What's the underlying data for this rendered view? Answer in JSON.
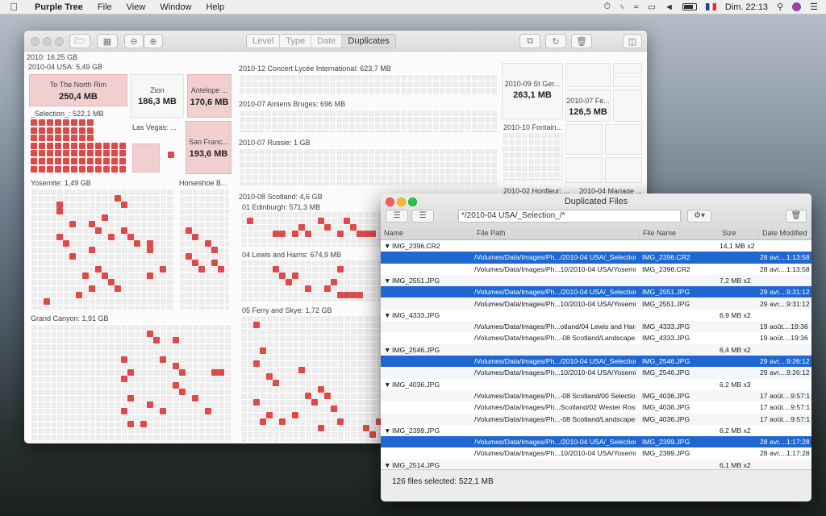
{
  "menubar": {
    "app_name": "Purple Tree",
    "items": [
      "File",
      "View",
      "Window",
      "Help"
    ],
    "clock": "Dim. 22:13"
  },
  "main_window": {
    "view_tabs": [
      "Level",
      "Type",
      "Date",
      "Duplicates"
    ],
    "selected_view_tab": "Duplicates",
    "treemap": {
      "root_label": "2010: 16,25 GB",
      "usa_label": "2010-04 USA: 5,49 GB",
      "north_rim_name": "To The North Rim",
      "north_rim_size": "250,4 MB",
      "zion_name": "Zion",
      "zion_size": "186,3 MB",
      "antelope_name": "Antelope ...",
      "antelope_size": "170,6 MB",
      "selection_label": "_Selection_: 522,1 MB",
      "las_vegas_label": "Las Vegas: ...",
      "san_fran_name": "San Franc...",
      "san_fran_size": "193,6 MB",
      "yosemite_label": "Yosemite: 1,49 GB",
      "horseshoe_label": "Horseshoe B...",
      "grand_canyon_label": "Grand Canyon: 1,91 GB",
      "concert_label": "2010-12 Concert Lycée International: 623,7 MB",
      "amiens_label": "2010-07 Amiens Bruges: 696 MB",
      "russie_label": "2010-07 Russie: 1 GB",
      "scotland_label": "2010-08 Scotland: 4,6 GB",
      "edinburgh_label": "01 Edinburgh: 571,3 MB",
      "lewis_label": "04 Lewis and Harris: 674,9 MB",
      "ferry_label": "05 Ferry and Skye: 1,72 GB",
      "st_ger_name": "2010-09 St Ger...",
      "st_ger_size": "263,1 MB",
      "fe_name": "2010-07 Fe...",
      "fe_size": "126,5 MB",
      "fontain_label": "2010-10 Fontain...",
      "honfleur_label": "2010-02 Honfleur: ...",
      "mariage_label": "2010-04 Mariage ..."
    }
  },
  "dup_window": {
    "title": "Duplicated Files",
    "path_value": "*/2010-04 USA/_Selection_/*",
    "columns": [
      "Name",
      "File Path",
      "File Name",
      "Size",
      "Date Modified"
    ],
    "rows": [
      {
        "type": "group",
        "name": "IMG_2396.CR2",
        "size": "14,1 MB x2"
      },
      {
        "type": "file",
        "selected": true,
        "path": "/Volumes/Data/Images/Ph.../2010-04 USA/_Selection_",
        "file": "IMG_2396.CR2",
        "date": "28 avr....1:13:58"
      },
      {
        "type": "file",
        "selected": false,
        "path": "/Volumes/Data/Images/Ph...10/2010-04 USA/Yosemite",
        "file": "IMG_2396.CR2",
        "date": "28 avr....1:13:58"
      },
      {
        "type": "group",
        "name": "IMG_2551.JPG",
        "size": "7,2 MB x2"
      },
      {
        "type": "file",
        "selected": true,
        "path": "/Volumes/Data/Images/Ph.../2010-04 USA/_Selection_",
        "file": "IMG_2551.JPG",
        "date": "29 avr....9:31:12"
      },
      {
        "type": "file",
        "selected": false,
        "path": "/Volumes/Data/Images/Ph...10/2010-04 USA/Yosemite",
        "file": "IMG_2551.JPG",
        "date": "29 avr....9:31:12"
      },
      {
        "type": "group",
        "name": "IMG_4333.JPG",
        "size": "6,9 MB x2"
      },
      {
        "type": "file",
        "selected": false,
        "path": "/Volumes/Data/Images/Ph...otland/04 Lewis and Harris",
        "file": "IMG_4333.JPG",
        "date": "19 août....19:36"
      },
      {
        "type": "file",
        "selected": false,
        "path": "/Volumes/Data/Images/Ph...-08 Scotland/Landscapes",
        "file": "IMG_4333.JPG",
        "date": "19 août....19:36"
      },
      {
        "type": "group",
        "name": "IMG_2546.JPG",
        "size": "6,4 MB x2"
      },
      {
        "type": "file",
        "selected": true,
        "path": "/Volumes/Data/Images/Ph.../2010-04 USA/_Selection_",
        "file": "IMG_2546.JPG",
        "date": "29 avr....9:26:12"
      },
      {
        "type": "file",
        "selected": false,
        "path": "/Volumes/Data/Images/Ph...10/2010-04 USA/Yosemite",
        "file": "IMG_2546.JPG",
        "date": "29 avr....9:26:12"
      },
      {
        "type": "group",
        "name": "IMG_4036.JPG",
        "size": "6,2 MB x3"
      },
      {
        "type": "file",
        "selected": false,
        "path": "/Volumes/Data/Images/Ph...-08 Scotland/00 Selection",
        "file": "IMG_4036.JPG",
        "date": "17 août....9:57:12"
      },
      {
        "type": "file",
        "selected": false,
        "path": "/Volumes/Data/Images/Ph...Scotland/02 Wester Ross",
        "file": "IMG_4036.JPG",
        "date": "17 août....9:57:12"
      },
      {
        "type": "file",
        "selected": false,
        "path": "/Volumes/Data/Images/Ph...-08 Scotland/Landscapes",
        "file": "IMG_4036.JPG",
        "date": "17 août....9:57:12"
      },
      {
        "type": "group",
        "name": "IMG_2399.JPG",
        "size": "6,2 MB x2"
      },
      {
        "type": "file",
        "selected": true,
        "path": "/Volumes/Data/Images/Ph.../2010-04 USA/_Selection_",
        "file": "IMG_2399.JPG",
        "date": "28 avr....1:17:28"
      },
      {
        "type": "file",
        "selected": false,
        "path": "/Volumes/Data/Images/Ph...10/2010-04 USA/Yosemite",
        "file": "IMG_2399.JPG",
        "date": "28 avr....1:17:28"
      },
      {
        "type": "group",
        "name": "IMG_2514.JPG",
        "size": "6,1 MB x2"
      }
    ],
    "status": "126 files selected: 522,1 MB"
  },
  "colors": {
    "accent_selection": "#1f67d1",
    "duplicate_red": "#dd4a4a",
    "selection_pink": "#f1cfcf"
  }
}
